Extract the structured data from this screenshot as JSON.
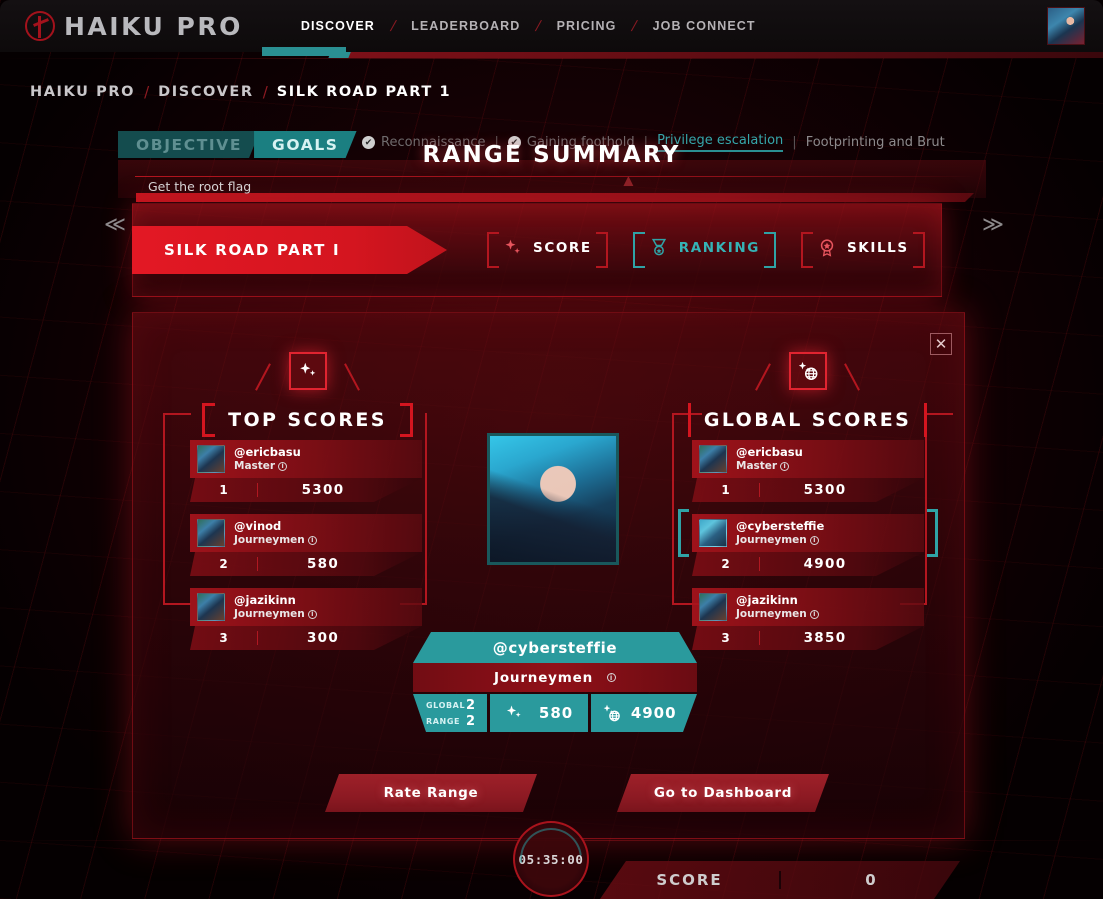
{
  "brand": {
    "name": "HAIKU PRO",
    "logo_icon": "haiku-logo-icon"
  },
  "nav": {
    "links": [
      {
        "label": "DISCOVER",
        "active": true
      },
      {
        "label": "LEADERBOARD",
        "active": false
      },
      {
        "label": "PRICING",
        "active": false
      },
      {
        "label": "JOB CONNECT",
        "active": false
      }
    ],
    "separator": "/",
    "avatar_icon": "user-avatar-icon"
  },
  "breadcrumb": {
    "items": [
      "HAIKU PRO",
      "DISCOVER",
      "SILK ROAD PART 1"
    ],
    "separator": "/"
  },
  "objective_tabs": [
    {
      "label": "OBJECTIVE",
      "active": false
    },
    {
      "label": "GOALS",
      "active": true
    }
  ],
  "steps": [
    {
      "label": "Reconnaissance",
      "state": "done",
      "check": "✔"
    },
    {
      "label": "Gaining foothold",
      "state": "done",
      "check": "✔"
    },
    {
      "label": "Privilege escalation",
      "state": "active",
      "check": ""
    },
    {
      "label": "Footprinting and Brut",
      "state": "todo",
      "check": ""
    }
  ],
  "step_divider": "|",
  "page_title": "RANGE SUMMARY",
  "objective": {
    "text": "Get the root flag",
    "collapse_icon": "chevron-up-icon"
  },
  "range_selector": {
    "current_range": "SILK ROAD PART I",
    "prev_icon": "double-chevron-left-icon",
    "next_icon": "double-chevron-right-icon",
    "tabs": [
      {
        "label": "SCORE",
        "icon": "sparkle-icon",
        "active": false
      },
      {
        "label": "RANKING",
        "icon": "medal-icon",
        "active": true
      },
      {
        "label": "SKILLS",
        "icon": "badge-icon",
        "active": false
      }
    ]
  },
  "close_icon": "close-icon",
  "columns": {
    "top_scores": {
      "title": "TOP SCORES",
      "icon": "sparkle-icon",
      "rows": [
        {
          "name": "@ericbasu",
          "tier": "Master",
          "rank": "1",
          "score": "5300",
          "highlight": false
        },
        {
          "name": "@vinod",
          "tier": "Journeymen",
          "rank": "2",
          "score": "580",
          "highlight": false
        },
        {
          "name": "@jazikinn",
          "tier": "Journeymen",
          "rank": "3",
          "score": "300",
          "highlight": false
        }
      ]
    },
    "global_scores": {
      "title": "GLOBAL SCORES",
      "icon": "sparkle-globe-icon",
      "rows": [
        {
          "name": "@ericbasu",
          "tier": "Master",
          "rank": "1",
          "score": "5300",
          "highlight": false
        },
        {
          "name": "@cybersteffie",
          "tier": "Journeymen",
          "rank": "2",
          "score": "4900",
          "highlight": true
        },
        {
          "name": "@jazikinn",
          "tier": "Journeymen",
          "rank": "3",
          "score": "3850",
          "highlight": false
        }
      ]
    }
  },
  "player_card": {
    "portrait_icon": "player-portrait-icon",
    "username": "@cybersteffie",
    "tier": "Journeymen",
    "info_icon": "info-icon",
    "global_label": "GLOBAL",
    "global_rank": "2",
    "range_label": "RANGE",
    "range_rank": "2",
    "range_score": "580",
    "global_score": "4900",
    "range_icon": "sparkle-icon",
    "global_icon": "sparkle-globe-icon"
  },
  "actions": [
    {
      "label": "Rate Range"
    },
    {
      "label": "Go to Dashboard"
    }
  ],
  "footer": {
    "timer": "05:35:00",
    "score_label": "SCORE",
    "score_value": "0"
  },
  "colors": {
    "accent_red": "#d4151f",
    "accent_teal": "#2a9a9d",
    "background": "#040102"
  }
}
